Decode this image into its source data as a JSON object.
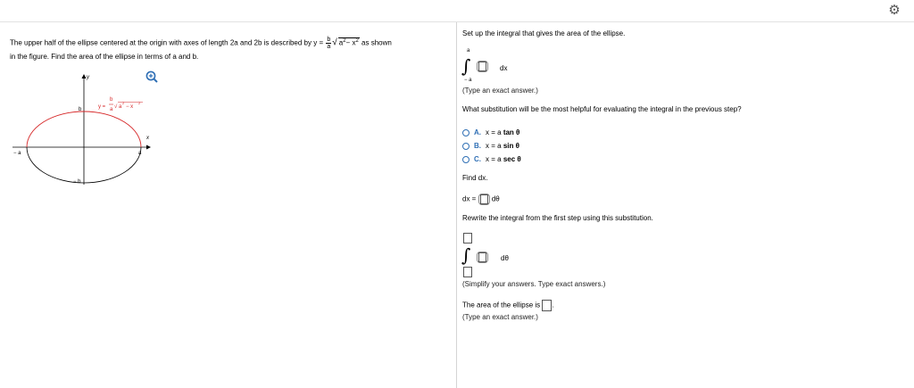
{
  "question": {
    "line1_pre": "The upper half of the ellipse centered at the origin with axes of length 2a and 2b is described by y =",
    "frac_num": "b",
    "frac_den": "a",
    "radicand": "a",
    "radicand_minus": "− x",
    "exp2": "2",
    "line1_post": "as shown",
    "line2": "in the figure. Find the area of the ellipse in terms of a and b."
  },
  "figure": {
    "y_axis": "y",
    "x_axis": "x",
    "b_top": "b",
    "b_bottom": "− b",
    "a_left": "− a",
    "a_right": "a",
    "curve_label_y": "y =",
    "curve_label_b": "b",
    "curve_label_a": "a",
    "curve_label_rad": "a",
    "curve_label_rad2": "− x",
    "exp2": "2"
  },
  "panel": {
    "step1": "Set up the integral that gives the area of the ellipse.",
    "upper_limit": "a",
    "lower_limit": "− a",
    "dx": "dx",
    "hint_exact": "(Type an exact answer.)",
    "step2": "What substitution will be the most helpful for evaluating the integral in the previous step?",
    "options": [
      {
        "letter": "A.",
        "text": "x = a",
        "fn": "tan θ"
      },
      {
        "letter": "B.",
        "text": "x = a",
        "fn": "sin θ"
      },
      {
        "letter": "C.",
        "text": "x = a",
        "fn": "sec θ"
      }
    ],
    "find_dx": "Find dx.",
    "dx_eq": "dx =",
    "dtheta": "dθ",
    "step3": "Rewrite the integral from the first step using this substitution.",
    "dtheta2": "dθ",
    "hint_simplify": "(Simplify your answers. Type exact answers.)",
    "area_text": "The area of the ellipse is",
    "area_period": ".",
    "hint_exact2": "(Type an exact answer.)"
  },
  "colors": {
    "ellipse_upper": "#d62728",
    "ellipse_lower": "#000000",
    "accent": "#2f6fb5"
  },
  "icons": {
    "settings": "gear-icon",
    "zoom": "zoom-in-icon"
  }
}
